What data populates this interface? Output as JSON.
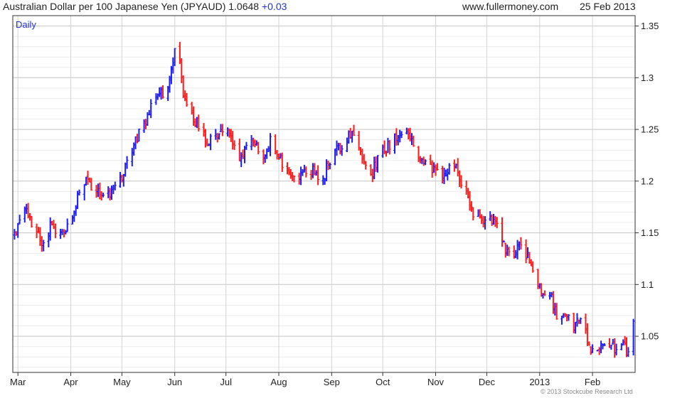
{
  "header": {
    "title_main": "Australian Dollar per 100 Japanese Yen (JPYAUD) 1.0648 ",
    "title_change": "+0.03",
    "site": "www.fullermoney.com",
    "date": "25 Feb 2013"
  },
  "footer": {
    "copyright": "© 2013 Stockcube Research Ltd"
  },
  "colors": {
    "up": "#1a1aff",
    "down": "#ff1a1a",
    "grid": "#d9d9d9",
    "frame": "#333333",
    "label": "#2233cc"
  },
  "chart_data": {
    "type": "ohlc",
    "interval_label": "Daily",
    "title": "Australian Dollar per 100 Japanese Yen (JPYAUD)",
    "last_value": 1.0648,
    "change": 0.03,
    "ylim": [
      1.015,
      1.36
    ],
    "yticks": [
      1.05,
      1.1,
      1.15,
      1.2,
      1.25,
      1.3,
      1.35
    ],
    "ytick_labels": [
      "1.05",
      "1.1",
      "1.15",
      "1.2",
      "1.25",
      "1.3",
      "1.35"
    ],
    "y_axis_side": "right",
    "grid": true,
    "xlim": [
      "2012-02-27",
      "2013-02-26"
    ],
    "months": [
      {
        "label": "Mar",
        "date": "2012-03-01"
      },
      {
        "label": "Apr",
        "date": "2012-04-01"
      },
      {
        "label": "May",
        "date": "2012-05-01"
      },
      {
        "label": "Jun",
        "date": "2012-06-01"
      },
      {
        "label": "Jul",
        "date": "2012-07-01"
      },
      {
        "label": "Aug",
        "date": "2012-08-01"
      },
      {
        "label": "Sep",
        "date": "2012-09-01"
      },
      {
        "label": "Oct",
        "date": "2012-10-01"
      },
      {
        "label": "Nov",
        "date": "2012-11-01"
      },
      {
        "label": "Dec",
        "date": "2012-12-01"
      },
      {
        "label": "2013",
        "date": "2013-01-01"
      },
      {
        "label": "Feb",
        "date": "2013-02-01"
      }
    ],
    "anchors": [
      [
        "2012-02-28",
        1.15
      ],
      [
        "2012-03-05",
        1.175
      ],
      [
        "2012-03-12",
        1.15
      ],
      [
        "2012-03-16",
        1.135
      ],
      [
        "2012-03-21",
        1.16
      ],
      [
        "2012-03-26",
        1.145
      ],
      [
        "2012-04-02",
        1.17
      ],
      [
        "2012-04-10",
        1.2
      ],
      [
        "2012-04-16",
        1.19
      ],
      [
        "2012-04-23",
        1.185
      ],
      [
        "2012-04-30",
        1.2
      ],
      [
        "2012-05-08",
        1.235
      ],
      [
        "2012-05-15",
        1.26
      ],
      [
        "2012-05-22",
        1.285
      ],
      [
        "2012-05-28",
        1.285
      ],
      [
        "2012-06-01",
        1.33
      ],
      [
        "2012-06-04",
        1.31
      ],
      [
        "2012-06-07",
        1.275
      ],
      [
        "2012-06-14",
        1.255
      ],
      [
        "2012-06-20",
        1.24
      ],
      [
        "2012-06-27",
        1.245
      ],
      [
        "2012-07-02",
        1.245
      ],
      [
        "2012-07-09",
        1.22
      ],
      [
        "2012-07-16",
        1.24
      ],
      [
        "2012-07-23",
        1.225
      ],
      [
        "2012-07-27",
        1.24
      ],
      [
        "2012-07-31",
        1.225
      ],
      [
        "2012-08-06",
        1.21
      ],
      [
        "2012-08-13",
        1.205
      ],
      [
        "2012-08-20",
        1.21
      ],
      [
        "2012-08-27",
        1.205
      ],
      [
        "2012-09-04",
        1.23
      ],
      [
        "2012-09-11",
        1.245
      ],
      [
        "2012-09-14",
        1.245
      ],
      [
        "2012-09-20",
        1.22
      ],
      [
        "2012-09-25",
        1.21
      ],
      [
        "2012-10-01",
        1.23
      ],
      [
        "2012-10-08",
        1.24
      ],
      [
        "2012-10-12",
        1.25
      ],
      [
        "2012-10-17",
        1.245
      ],
      [
        "2012-10-22",
        1.22
      ],
      [
        "2012-10-29",
        1.215
      ],
      [
        "2012-11-05",
        1.205
      ],
      [
        "2012-11-12",
        1.215
      ],
      [
        "2012-11-19",
        1.19
      ],
      [
        "2012-11-23",
        1.17
      ],
      [
        "2012-11-30",
        1.165
      ],
      [
        "2012-12-07",
        1.16
      ],
      [
        "2012-12-12",
        1.13
      ],
      [
        "2012-12-18",
        1.13
      ],
      [
        "2012-12-21",
        1.14
      ],
      [
        "2012-12-27",
        1.12
      ],
      [
        "2013-01-02",
        1.09
      ],
      [
        "2013-01-08",
        1.09
      ],
      [
        "2013-01-11",
        1.065
      ],
      [
        "2013-01-16",
        1.075
      ],
      [
        "2013-01-21",
        1.06
      ],
      [
        "2013-01-25",
        1.065
      ],
      [
        "2013-01-31",
        1.04
      ],
      [
        "2013-02-06",
        1.04
      ],
      [
        "2013-02-12",
        1.04
      ],
      [
        "2013-02-19",
        1.04
      ],
      [
        "2013-02-22",
        1.035
      ],
      [
        "2013-02-25",
        1.06
      ]
    ]
  }
}
